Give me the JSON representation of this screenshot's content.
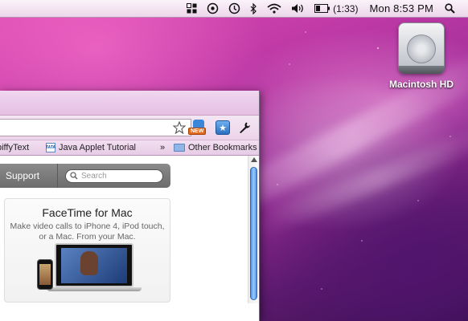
{
  "menubar": {
    "status_icons": [
      "spaces-icon",
      "time-machine-icon",
      "sync-icon",
      "bluetooth-icon",
      "wifi-icon",
      "volume-icon",
      "battery-icon"
    ],
    "battery_time": "(1:33)",
    "clock": "Mon 8:53 PM",
    "spotlight_icon": "spotlight-search-icon"
  },
  "desktop": {
    "hd_label": "Macintosh HD"
  },
  "browser": {
    "toolbar": {
      "bookmark_star_icon": "bookmark-star-icon",
      "extension_new_label": "NEW",
      "extension_star_icon": "extension-star-icon",
      "wrench_icon": "wrench-icon"
    },
    "bookmarks": {
      "items": [
        {
          "label": "piffyText"
        },
        {
          "label": "Java Applet Tutorial",
          "favicon_text": "TATA"
        }
      ],
      "overflow": "»",
      "other": "Other Bookmarks"
    },
    "page": {
      "nav_support": "Support",
      "search_placeholder": "Search",
      "promo_title": "FaceTime for Mac",
      "promo_desc": "Make video calls to iPhone 4, iPod touch, or a Mac. From your Mac."
    }
  }
}
